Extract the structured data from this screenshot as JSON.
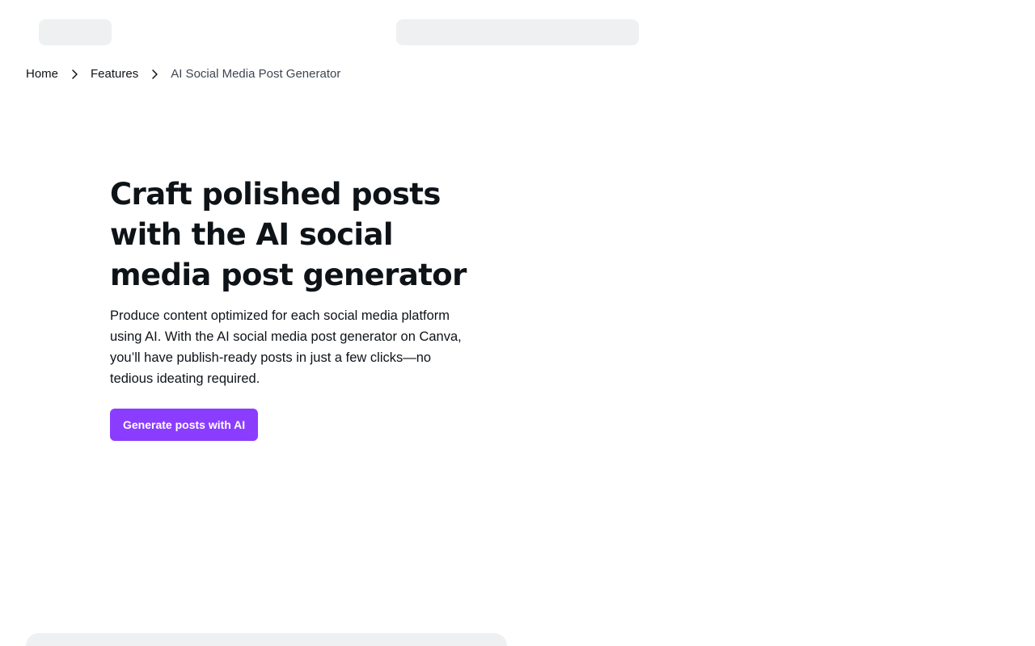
{
  "breadcrumb": {
    "items": [
      "Home",
      "Features"
    ],
    "current": "AI Social Media Post Generator"
  },
  "hero": {
    "title": "Craft polished posts with the AI social media post generator",
    "description": "Produce content optimized for each social media platform using AI. With the AI social media post generator on Canva, you’ll have publish-ready posts in just a few clicks—no tedious ideating required.",
    "cta_label": "Generate posts with AI"
  },
  "colors": {
    "accent": "#8b3dff",
    "text": "#0e1318",
    "skeleton": "#eff0f2"
  },
  "icons": {
    "breadcrumb_separator": "chevron-right-icon"
  }
}
